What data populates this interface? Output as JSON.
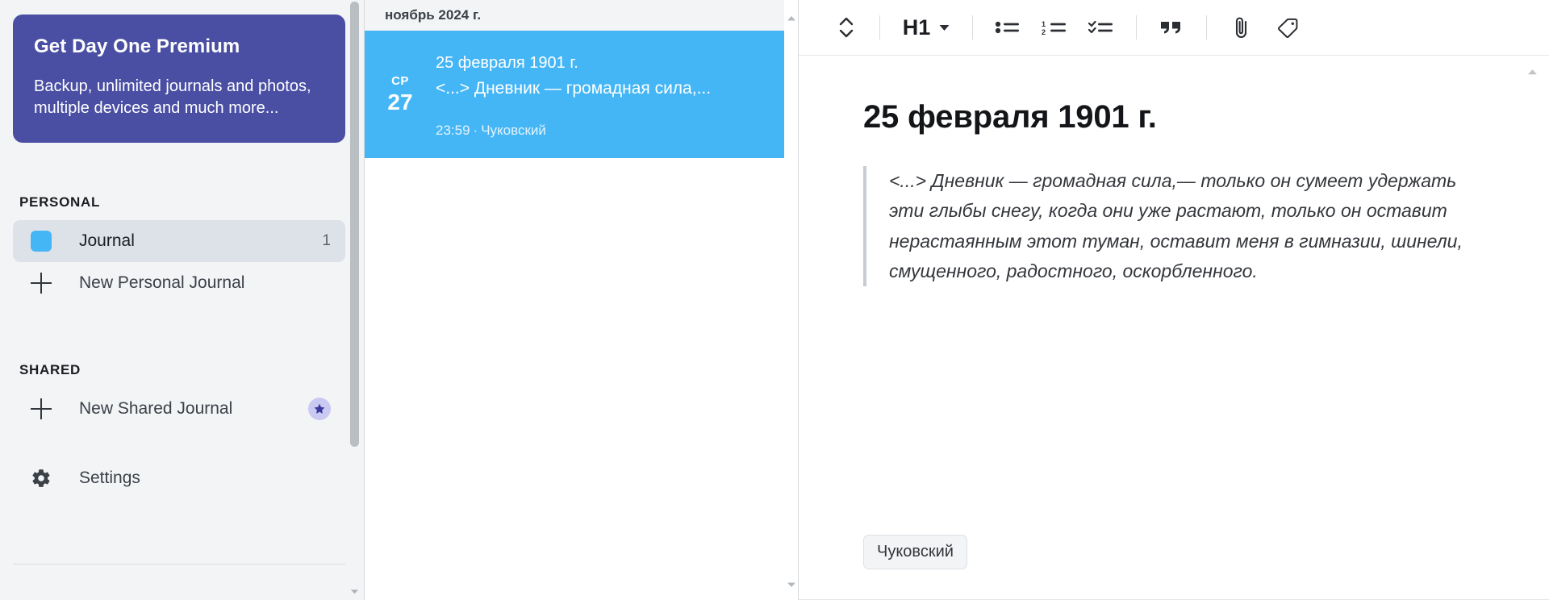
{
  "sidebar": {
    "promo": {
      "title": "Get Day One Premium",
      "body": "Backup, unlimited journals and photos, multiple devices and much more..."
    },
    "sections": [
      {
        "label": "PERSONAL"
      },
      {
        "label": "SHARED"
      }
    ],
    "journal_item": {
      "label": "Journal",
      "count": "1",
      "color": "#45b6f5"
    },
    "new_personal": {
      "label": "New Personal Journal"
    },
    "new_shared": {
      "label": "New Shared Journal"
    },
    "settings": {
      "label": "Settings"
    }
  },
  "entry_list": {
    "month_header": "ноябрь 2024 г.",
    "entries": [
      {
        "day_of_week": "СР",
        "day": "27",
        "title": "25 февраля 1901 г.",
        "preview": "<...> Дневник — громадная сила,...",
        "time": "23:59",
        "separator": "·",
        "journal": "Чуковский"
      }
    ]
  },
  "editor": {
    "toolbar": {
      "heading_label": "H1",
      "items": [
        "stepper-icon",
        "heading-dropdown",
        "bullet-list-icon",
        "numbered-list-icon",
        "checklist-icon",
        "quote-icon",
        "attachment-icon",
        "tag-icon"
      ]
    },
    "title": "25 февраля 1901 г.",
    "quote": "<...> Дневник — громадная сила,— только он сумеет удержать эти глыбы снегу, когда они уже растают, только он оставит нерастаянным этот туман, оставит меня в гимназии, шинели, смущенного, радостного, оскорбленного.",
    "tags": [
      "Чуковский"
    ]
  },
  "colors": {
    "accent_blue": "#45b6f5",
    "promo_purple": "#4a4fa3",
    "sidebar_bg": "#f2f4f6",
    "selected_row": "#dde2e8"
  }
}
